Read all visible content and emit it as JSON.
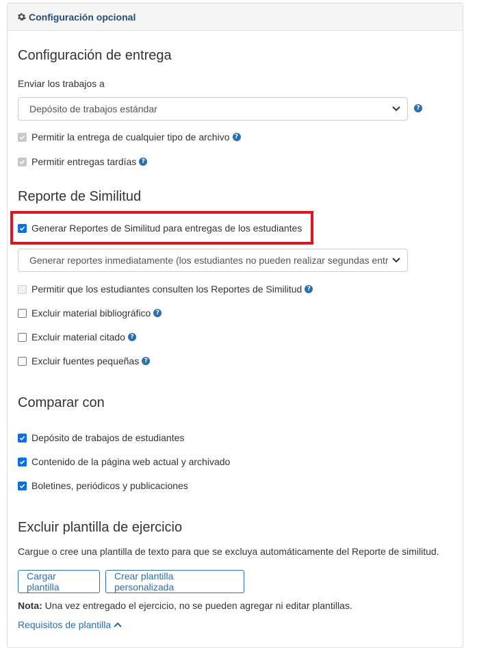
{
  "panel": {
    "title": "Configuración opcional"
  },
  "delivery": {
    "heading": "Configuración de entrega",
    "send_label": "Enviar los trabajos a",
    "send_value": "Depósito de trabajos estándar",
    "allow_any_file": "Permitir la entrega de cualquier tipo de archivo",
    "allow_late": "Permitir entregas tardías"
  },
  "similarity": {
    "heading": "Reporte de Similitud",
    "generate": "Generar Reportes de Similitud para entregas de los estudiantes",
    "generate_when": "Generar reportes inmediatamente (los estudiantes no pueden realizar segundas entr",
    "students_view": "Permitir que los estudiantes consulten los Reportes de Similitud",
    "exclude_bibliographic": "Excluir material bibliográfico",
    "exclude_quoted": "Excluir material citado",
    "exclude_small": "Excluir fuentes pequeñas"
  },
  "compare": {
    "heading": "Comparar con",
    "student_repository": "Depósito de trabajos de estudiantes",
    "web_content": "Contenido de la página web actual y archivado",
    "periodicals": "Boletines, periódicos y publicaciones"
  },
  "template": {
    "heading": "Excluir plantilla de ejercicio",
    "description": "Cargue o cree una plantilla de texto para que se excluya automáticamente del Reporte de similitud.",
    "upload_button": "Cargar plantilla",
    "create_button": "Crear plantilla personalizada",
    "note_label": "Nota:",
    "note_text": " Una vez entregado el ejercicio, no se pueden agregar ni editar plantillas.",
    "requirements_link": "Requisitos de plantilla"
  },
  "colors": {
    "accent": "#2a6fb0",
    "highlight": "#e0141e",
    "checkbox": "#0a6fe0"
  }
}
